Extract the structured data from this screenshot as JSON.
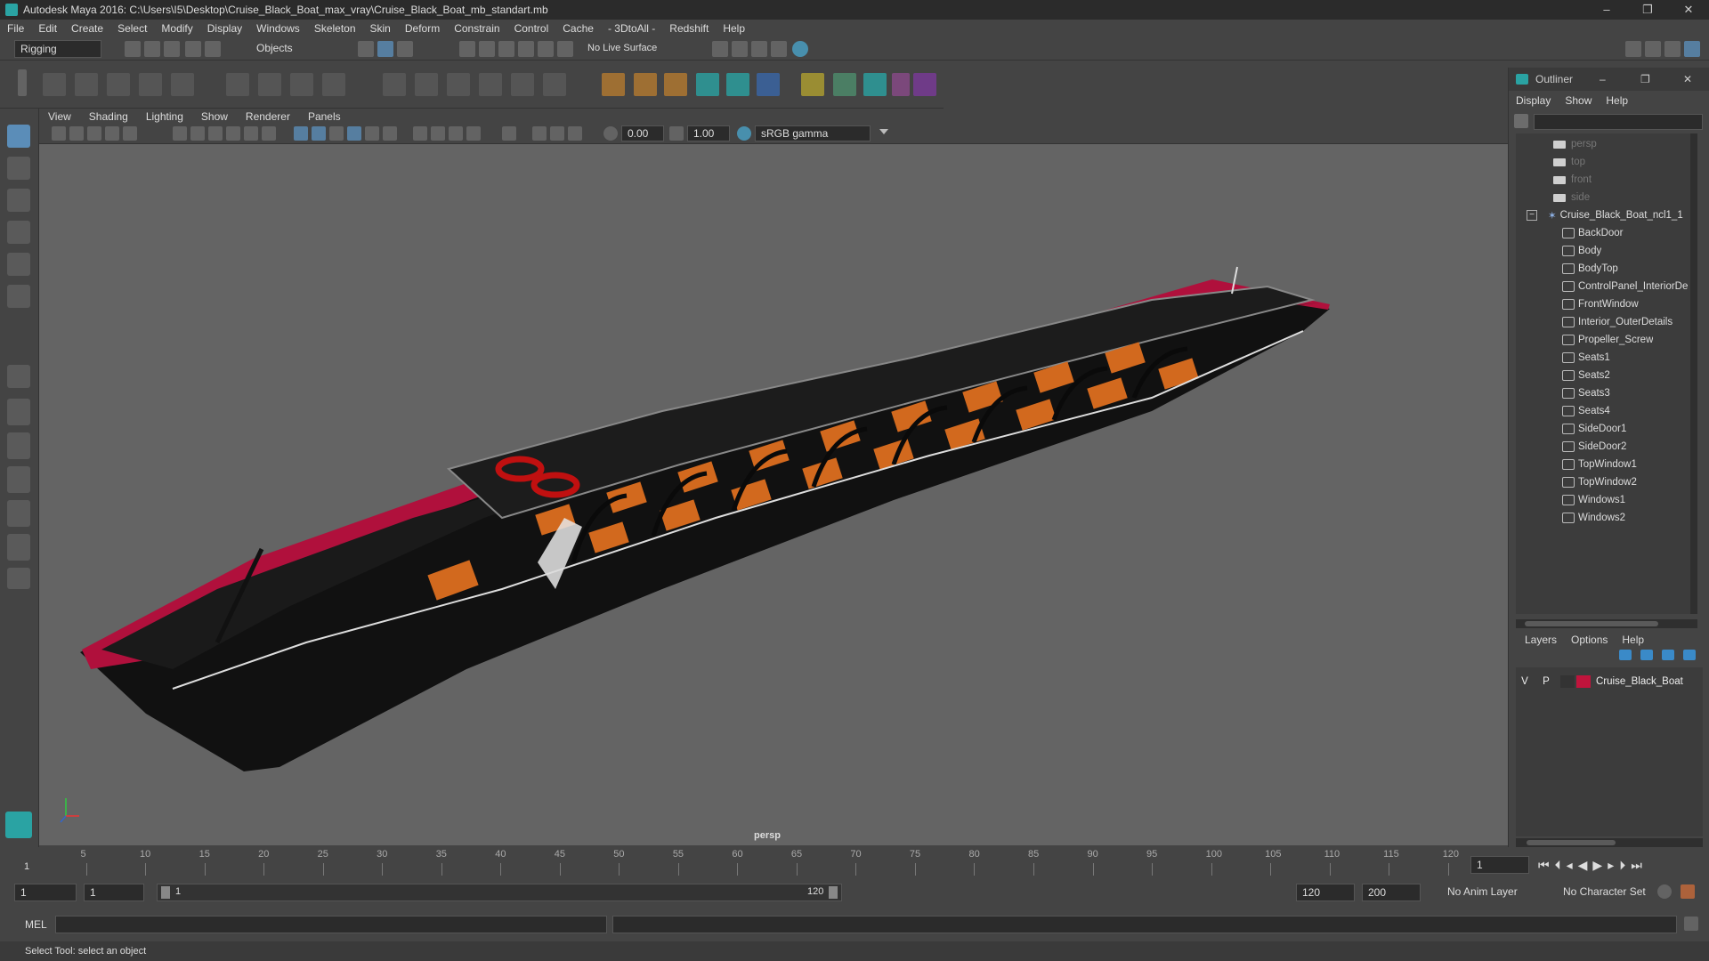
{
  "window": {
    "title": "Autodesk Maya 2016: C:\\Users\\I5\\Desktop\\Cruise_Black_Boat_max_vray\\Cruise_Black_Boat_mb_standart.mb",
    "minimize": "–",
    "maximize": "❐",
    "close": "✕"
  },
  "menubar": [
    "File",
    "Edit",
    "Create",
    "Select",
    "Modify",
    "Display",
    "Windows",
    "Skeleton",
    "Skin",
    "Deform",
    "Constrain",
    "Control",
    "Cache",
    "- 3DtoAll -",
    "Redshift",
    "Help"
  ],
  "statusline": {
    "mode_select": "Rigging",
    "objects_select": "Objects",
    "live_surface": "No Live Surface"
  },
  "viewport": {
    "menus": [
      "View",
      "Shading",
      "Lighting",
      "Show",
      "Renderer",
      "Panels"
    ],
    "exposure": "0.00",
    "gamma": "1.00",
    "color_space": "sRGB gamma",
    "camera_label": "persp"
  },
  "outliner": {
    "title": "Outliner",
    "menus": [
      "Display",
      "Show",
      "Help"
    ],
    "cameras": [
      "persp",
      "top",
      "front",
      "side"
    ],
    "root": "Cruise_Black_Boat_ncl1_1",
    "children": [
      "BackDoor",
      "Body",
      "BodyTop",
      "ControlPanel_InteriorDe",
      "FrontWindow",
      "Interior_OuterDetails",
      "Propeller_Screw",
      "Seats1",
      "Seats2",
      "Seats3",
      "Seats4",
      "SideDoor1",
      "SideDoor2",
      "TopWindow1",
      "TopWindow2",
      "Windows1",
      "Windows2"
    ]
  },
  "layers": {
    "tabs": [
      "Layers",
      "Options",
      "Help"
    ],
    "layer": {
      "v": "V",
      "p": "P",
      "name": "Cruise_Black_Boat",
      "color": "#c0143c"
    }
  },
  "timeline": {
    "ticks": [
      "5",
      "10",
      "15",
      "20",
      "25",
      "30",
      "35",
      "40",
      "45",
      "50",
      "55",
      "60",
      "65",
      "70",
      "75",
      "80",
      "85",
      "90",
      "95",
      "100",
      "105",
      "110",
      "115",
      "120"
    ],
    "start_marker": "1",
    "current_frame": "1"
  },
  "range": {
    "start": "1",
    "playback_start": "1",
    "slider_start": "1",
    "slider_end": "120",
    "playback_end": "120",
    "end": "200",
    "anim_layer": "No Anim Layer",
    "character_set": "No Character Set"
  },
  "cmdline": {
    "lang": "MEL"
  },
  "helpline": {
    "text": "Select Tool: select an object"
  },
  "colors": {
    "hull": "#111111",
    "stripe": "#b0103c",
    "seats": "#d2691e"
  }
}
